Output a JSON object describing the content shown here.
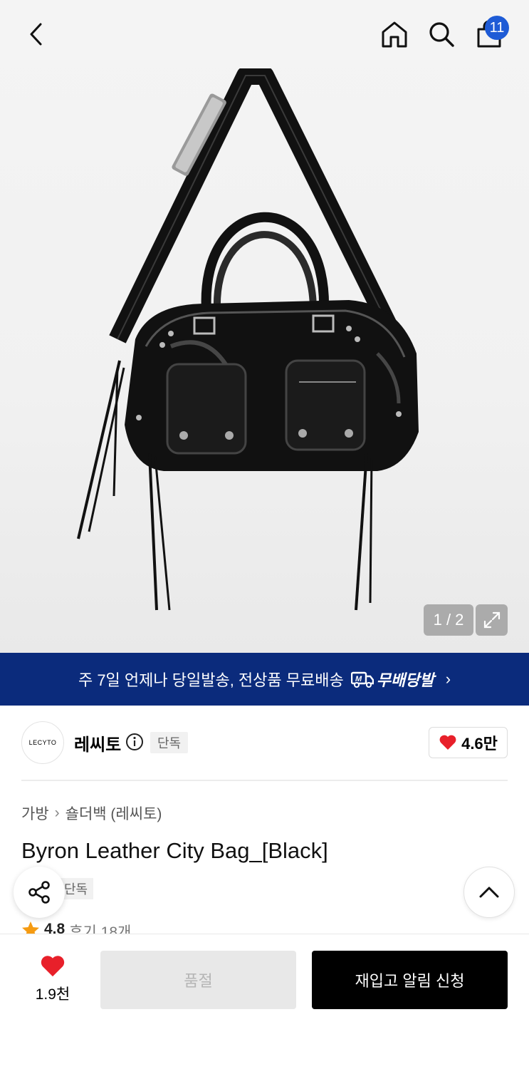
{
  "header": {
    "cart_count": "11"
  },
  "gallery": {
    "pager": "1 / 2"
  },
  "banner": {
    "text": "주 7일 언제나 당일발송, 전상품 무료배송",
    "brand_label": "무배당발",
    "brand_mark": "M"
  },
  "brand": {
    "logo_text": "LECYTO",
    "name": "레씨토",
    "exclusive_badge": "단독",
    "like_count": "4.6만"
  },
  "breadcrumb": {
    "category": "가방",
    "subcategory": "숄더백 (레씨토)"
  },
  "product": {
    "title": "Byron Leather City Bag_[Black]",
    "exclusive_badge": "단독",
    "rating": "4.8",
    "reviews": "후기 18개"
  },
  "bottom": {
    "wish_count": "1.9천",
    "soldout_label": "품절",
    "restock_label": "재입고 알림 신청"
  },
  "colors": {
    "banner_bg": "#0b2b7c",
    "badge_blue": "#1e5bd6",
    "heart_red": "#e8202a",
    "star_orange": "#f59b12"
  }
}
